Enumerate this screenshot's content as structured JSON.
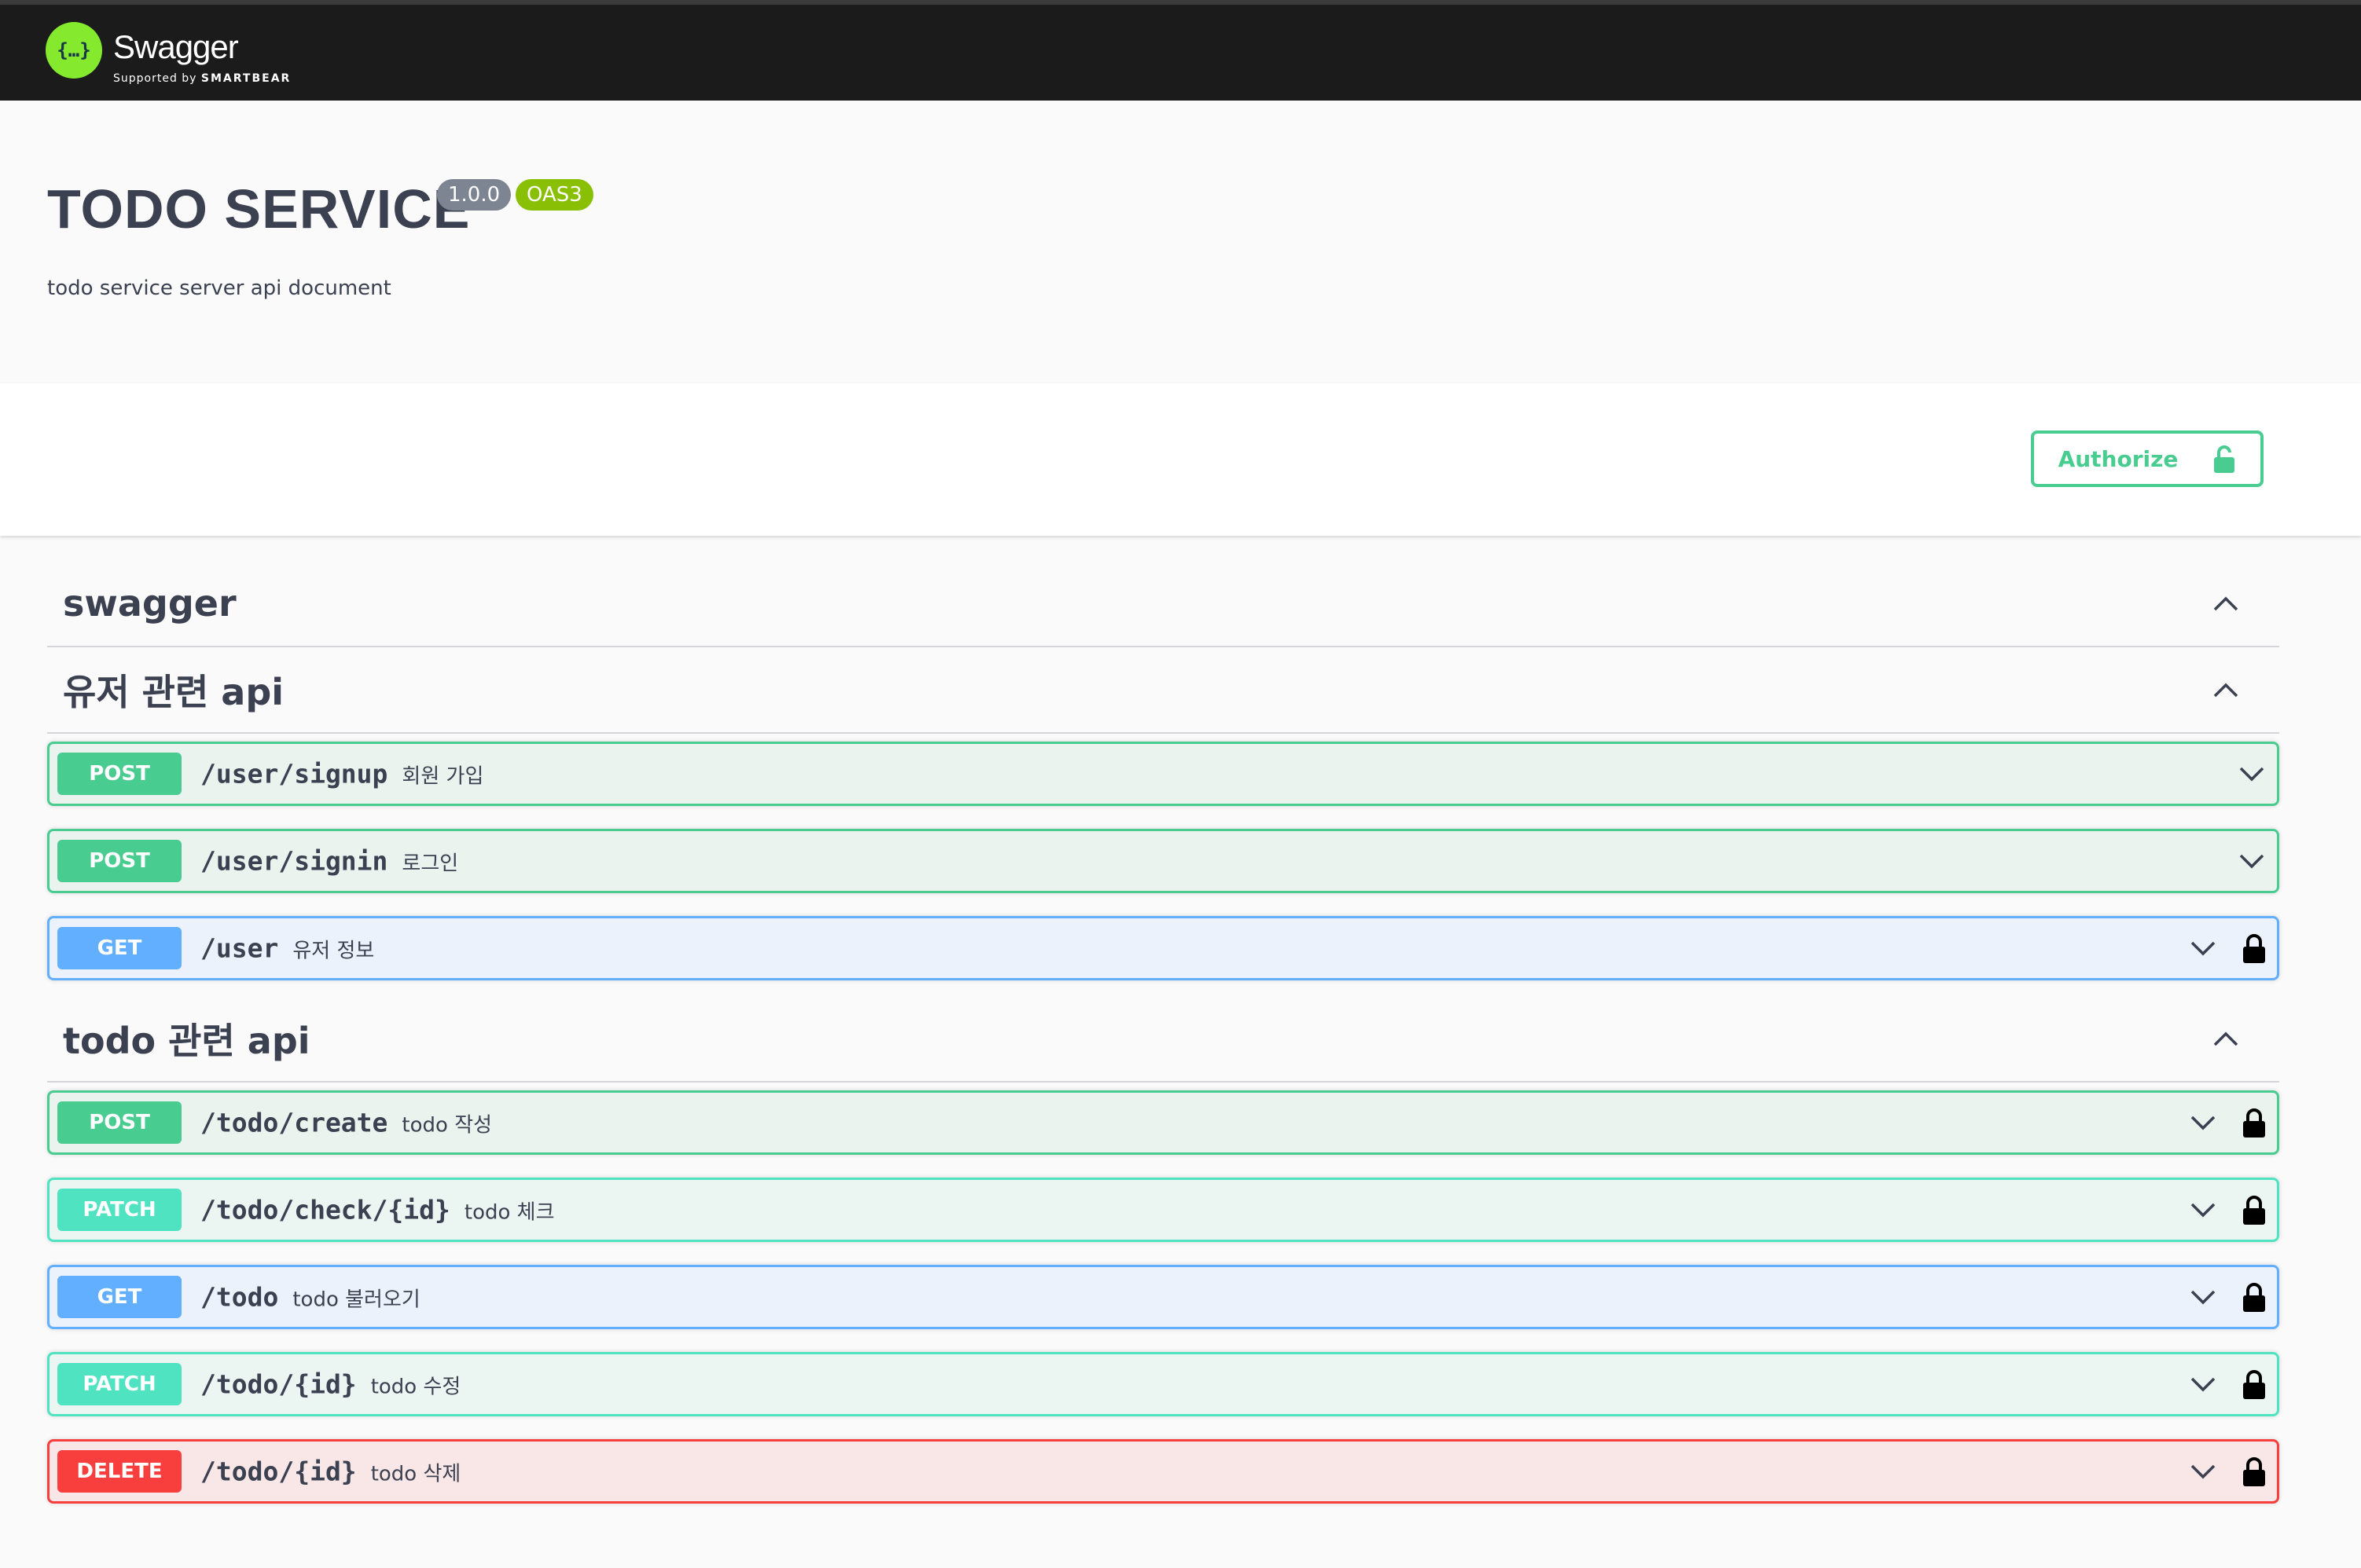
{
  "topbar": {
    "logo_word": "Swagger",
    "logo_sub_prefix": "Supported by",
    "logo_sub_brand": "SMARTBEAR"
  },
  "info": {
    "title": "TODO SERVICE",
    "version": "1.0.0",
    "oas": "OAS3",
    "description": "todo service server api document"
  },
  "auth": {
    "label": "Authorize"
  },
  "tags": [
    {
      "name": "swagger",
      "operations": []
    },
    {
      "name": "유저 관련 api",
      "operations": [
        {
          "method": "POST",
          "path": "/user/signup",
          "summary": "회원 가입",
          "locked": false
        },
        {
          "method": "POST",
          "path": "/user/signin",
          "summary": "로그인",
          "locked": false
        },
        {
          "method": "GET",
          "path": "/user",
          "summary": "유저 정보",
          "locked": true
        }
      ]
    },
    {
      "name": "todo 관련 api",
      "operations": [
        {
          "method": "POST",
          "path": "/todo/create",
          "summary": "todo 작성",
          "locked": true
        },
        {
          "method": "PATCH",
          "path": "/todo/check/{id}",
          "summary": "todo 체크",
          "locked": true
        },
        {
          "method": "GET",
          "path": "/todo",
          "summary": "todo 불러오기",
          "locked": true
        },
        {
          "method": "PATCH",
          "path": "/todo/{id}",
          "summary": "todo 수정",
          "locked": true
        },
        {
          "method": "DELETE",
          "path": "/todo/{id}",
          "summary": "todo 삭제",
          "locked": true
        }
      ]
    }
  ],
  "colors": {
    "post": "#49cc90",
    "get": "#61affe",
    "patch": "#50e3c2",
    "delete": "#f93e3e",
    "topbar": "#1b1b1b",
    "logo": "#85ea2d"
  },
  "icons": {
    "tag_toggle": "chevron-up-icon",
    "op_toggle": "chevron-down-icon",
    "lock": "lock-icon"
  }
}
